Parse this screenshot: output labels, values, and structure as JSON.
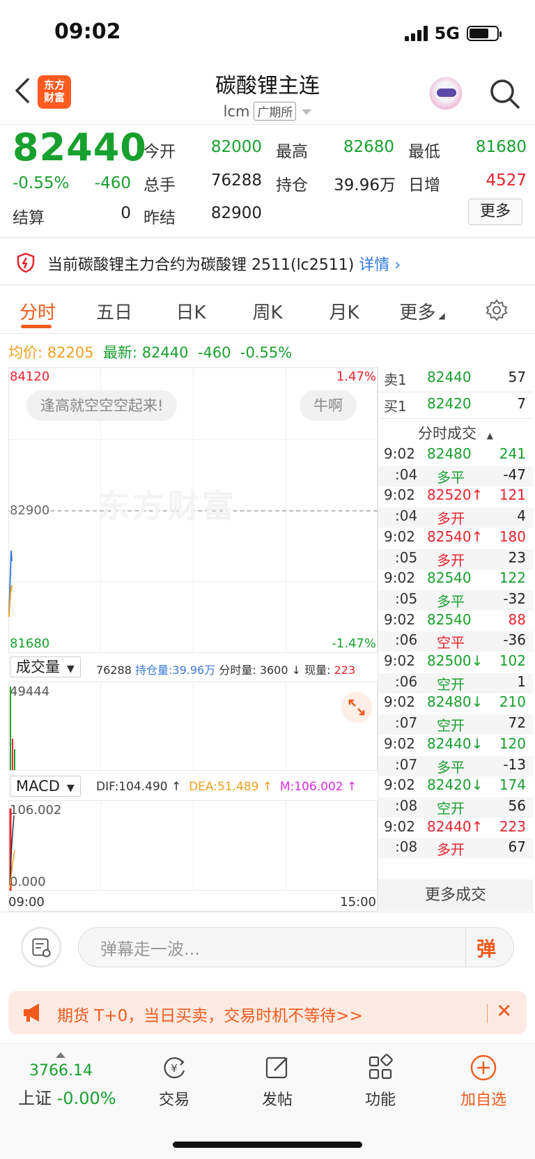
{
  "status": {
    "time": "09:02",
    "network": "5G"
  },
  "header": {
    "title": "碳酸锂主连",
    "code": "lcm",
    "exchange": "广期所",
    "logo_line1": "东方",
    "logo_line2": "财富"
  },
  "quote": {
    "price": "82440",
    "change_pct": "-0.55%",
    "change": "-460",
    "open_label": "今开",
    "open": "82000",
    "high_label": "最高",
    "high": "82680",
    "low_label": "最低",
    "low": "81680",
    "volume_label": "总手",
    "volume": "76288",
    "oi_label": "持仓",
    "oi": "39.96万",
    "daily_inc_label": "日增",
    "daily_inc": "4527",
    "settle_label": "结算",
    "settle": "0",
    "prev_settle_label": "昨结",
    "prev_settle": "82900",
    "more_label": "更多"
  },
  "notice": {
    "text": "当前碳酸锂主力合约为碳酸锂 2511(lc2511)",
    "link": "详情"
  },
  "tabs": [
    {
      "label": "分时",
      "active": true
    },
    {
      "label": "五日"
    },
    {
      "label": "日K"
    },
    {
      "label": "周K"
    },
    {
      "label": "月K"
    },
    {
      "label": "更多"
    }
  ],
  "infoline": {
    "avg_label": "均价:",
    "avg": "82205",
    "latest_label": "最新:",
    "latest": "82440",
    "chg": "-460",
    "pct": "-0.55%"
  },
  "chart": {
    "y_top": "84120",
    "y_top_pct": "1.47%",
    "y_mid": "82900",
    "y_bottom": "81680",
    "y_bottom_pct": "-1.47%",
    "watermark": "东方财富",
    "bubble_left": "逢高就空空空起来!",
    "bubble_right": "牛啊",
    "x_start": "09:00",
    "x_end": "15:00"
  },
  "volume_bar": {
    "selector": "成交量",
    "total": "76288",
    "oi_label": "持仓量:",
    "oi": "39.96万",
    "min_vol_label": "分时量:",
    "min_vol": "3600 ↓",
    "cur_label": "现量:",
    "cur": "223",
    "y_top": "49444"
  },
  "macd": {
    "selector": "MACD",
    "dif": "DIF:104.490 ↑",
    "dea": "DEA:51.489 ↑",
    "m": "M:106.002 ↑",
    "y_top": "106.002",
    "y_bottom": "0.000"
  },
  "orderbook": {
    "sell_label": "卖1",
    "sell_price": "82440",
    "sell_qty": "57",
    "buy_label": "买1",
    "buy_price": "82420",
    "buy_qty": "7"
  },
  "ticks_title": "分时成交",
  "ticks": [
    {
      "t": "9:02",
      "p": "82480",
      "v": "241",
      "pc": "green",
      "vc": "green"
    },
    {
      "t": ":04",
      "p": "多平",
      "v": "-47",
      "pc": "green",
      "vc": "dark"
    },
    {
      "t": "9:02",
      "p": "82520↑",
      "v": "121",
      "pc": "red",
      "vc": "red"
    },
    {
      "t": ":04",
      "p": "多开",
      "v": "4",
      "pc": "red",
      "vc": "dark"
    },
    {
      "t": "9:02",
      "p": "82540↑",
      "v": "180",
      "pc": "red",
      "vc": "red"
    },
    {
      "t": ":05",
      "p": "多开",
      "v": "23",
      "pc": "red",
      "vc": "dark"
    },
    {
      "t": "9:02",
      "p": "82540",
      "v": "122",
      "pc": "green",
      "vc": "green"
    },
    {
      "t": ":05",
      "p": "多平",
      "v": "-32",
      "pc": "green",
      "vc": "dark"
    },
    {
      "t": "9:02",
      "p": "82540",
      "v": "88",
      "pc": "green",
      "vc": "red"
    },
    {
      "t": ":06",
      "p": "空平",
      "v": "-36",
      "pc": "red",
      "vc": "dark"
    },
    {
      "t": "9:02",
      "p": "82500↓",
      "v": "102",
      "pc": "green",
      "vc": "green"
    },
    {
      "t": ":06",
      "p": "空开",
      "v": "1",
      "pc": "green",
      "vc": "dark"
    },
    {
      "t": "9:02",
      "p": "82480↓",
      "v": "210",
      "pc": "green",
      "vc": "green"
    },
    {
      "t": ":07",
      "p": "空开",
      "v": "72",
      "pc": "green",
      "vc": "dark"
    },
    {
      "t": "9:02",
      "p": "82440↓",
      "v": "120",
      "pc": "green",
      "vc": "green"
    },
    {
      "t": ":07",
      "p": "多平",
      "v": "-13",
      "pc": "green",
      "vc": "dark"
    },
    {
      "t": "9:02",
      "p": "82420↓",
      "v": "174",
      "pc": "green",
      "vc": "green"
    },
    {
      "t": ":08",
      "p": "空开",
      "v": "56",
      "pc": "green",
      "vc": "dark"
    },
    {
      "t": "9:02",
      "p": "82440↑",
      "v": "223",
      "pc": "red",
      "vc": "red"
    },
    {
      "t": ":08",
      "p": "多开",
      "v": "67",
      "pc": "red",
      "vc": "dark"
    }
  ],
  "ticks_more": "更多成交",
  "comment": {
    "placeholder": "弹幕走一波...",
    "button": "弹"
  },
  "banner": {
    "text": "期货 T+0，当日买卖，交易时机不等待>>",
    "close": "✕"
  },
  "bottom_nav": {
    "index_value": "3766.14",
    "index_name": "上证",
    "index_chg": "-0.00%",
    "items": [
      {
        "label": "交易"
      },
      {
        "label": "发帖"
      },
      {
        "label": "功能"
      },
      {
        "label": "加自选"
      }
    ]
  },
  "colors": {
    "green": "#17a02e",
    "red": "#e8232e",
    "accent": "#f05a1c",
    "avg_line": "#f0a020",
    "price_line": "#3a7bd5"
  }
}
